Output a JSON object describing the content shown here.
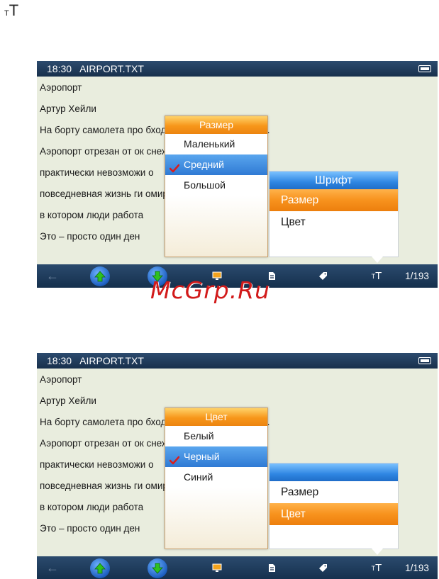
{
  "page": {
    "top_glyph_small": "T",
    "top_glyph_big": "T"
  },
  "watermark": "McGrp.Ru",
  "colors": {
    "accent_orange": "#f7921d",
    "accent_blue": "#2f7ad4",
    "bar_navy": "#1f3a5a",
    "page_bg": "#e9edde",
    "check_red": "#d81e1e"
  },
  "screens": [
    {
      "status": {
        "time": "18:30",
        "filename": "AIRPORT.TXT",
        "battery_icon": "battery-icon"
      },
      "lines": [
        "Аэропорт",
        "Артур Хейли",
        "На борту самолета про          бходима срочная посадка…",
        "Аэропорт отрезан от ок          снежной бурей – и посадка",
        "практически невозможи          о",
        "повседневная жизнь ги          омира,",
        "в котором люди работа",
        "Это – просто один ден"
      ],
      "submenu": {
        "title": "Размер",
        "items": [
          {
            "label": "Маленький",
            "selected": false
          },
          {
            "label": "Средний",
            "selected": true
          },
          {
            "label": "Большой",
            "selected": false
          }
        ]
      },
      "menu": {
        "title": "Шрифт",
        "items": [
          {
            "label": "Размер",
            "selected": true
          },
          {
            "label": "Цвет",
            "selected": false
          }
        ]
      },
      "bottom": {
        "icons": [
          "back-arrow-icon",
          "arrow-up-icon",
          "arrow-down-icon",
          "monitor-icon",
          "document-icon",
          "tag-icon",
          "font-size-icon"
        ],
        "tt_small": "T",
        "tt_big": "T",
        "page_indicator": "1/193"
      }
    },
    {
      "status": {
        "time": "18:30",
        "filename": "AIRPORT.TXT",
        "battery_icon": "battery-icon"
      },
      "lines": [
        "Аэропорт",
        "Артур Хейли",
        "На борту самолета про          бходима срочная посадка…",
        "Аэропорт отрезан от ок          снежной бурей – и посадка",
        "практически невозможи          о",
        "повседневная жизнь ги          омира,",
        "в котором люди работа",
        "Это – просто один ден"
      ],
      "submenu": {
        "title": "Цвет",
        "items": [
          {
            "label": "Белый",
            "selected": false
          },
          {
            "label": "Черный",
            "selected": true
          },
          {
            "label": "Синий",
            "selected": false
          }
        ]
      },
      "menu": {
        "title": "",
        "items": [
          {
            "label": "Размер",
            "selected": false
          },
          {
            "label": "Цвет",
            "selected": true
          }
        ]
      },
      "bottom": {
        "icons": [
          "back-arrow-icon",
          "arrow-up-icon",
          "arrow-down-icon",
          "monitor-icon",
          "document-icon",
          "tag-icon",
          "font-size-icon"
        ],
        "tt_small": "T",
        "tt_big": "T",
        "page_indicator": "1/193"
      }
    }
  ]
}
